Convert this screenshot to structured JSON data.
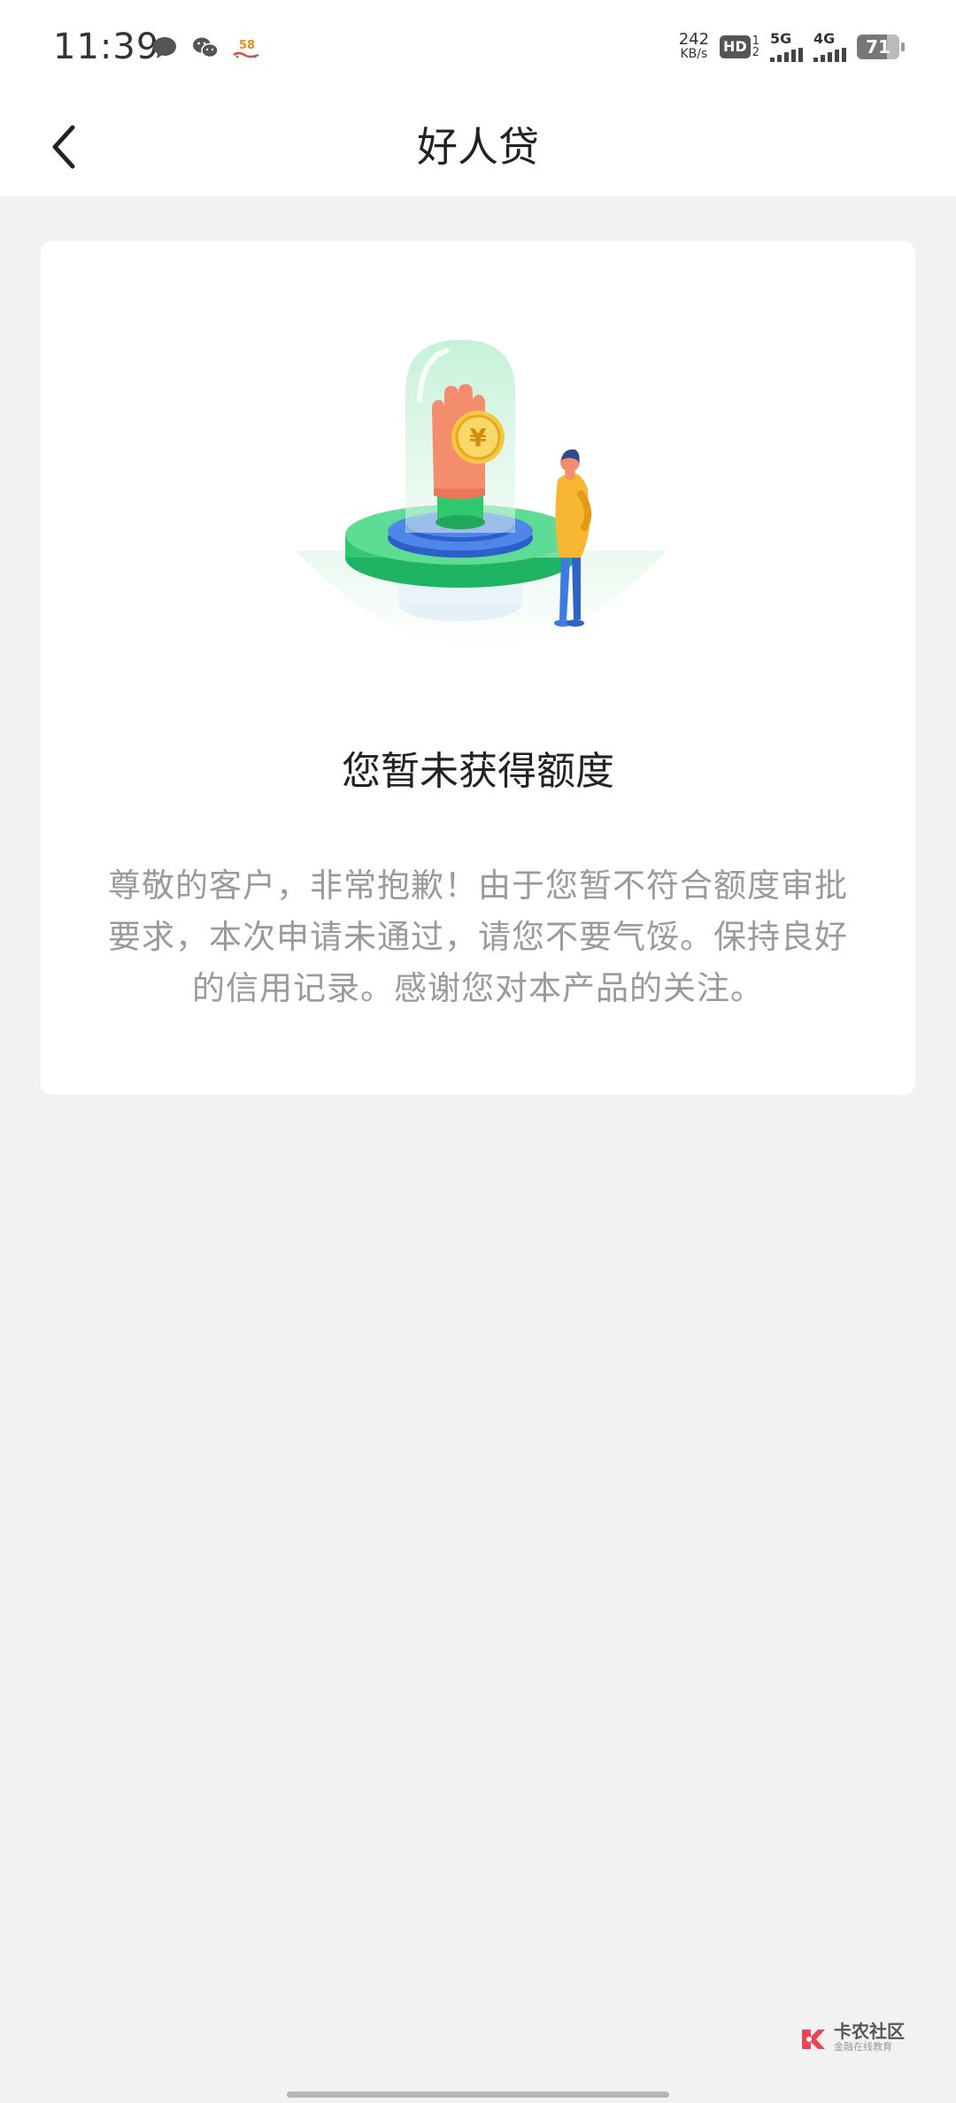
{
  "status_bar": {
    "time": "11:39",
    "notification_icons": [
      "message-bubble-icon",
      "wechat-icon",
      "58-app-icon"
    ],
    "net_speed_value": "242",
    "net_speed_unit": "KB/s",
    "hd_label": "HD",
    "hd_sub_top": "1",
    "hd_sub_bottom": "2",
    "signal_1_label": "5G",
    "signal_2_label": "4G",
    "battery_level": "71"
  },
  "header": {
    "back_icon": "chevron-left-icon",
    "title": "好人贷"
  },
  "result": {
    "illustration": "hand-with-coin-under-glass-dome-illustration",
    "title": "您暂未获得额度",
    "description": "尊敬的客户，非常抱歉！由于您暂不符合额度审批要求，本次申请未通过，请您不要气馁。保持良好的信用记录。感谢您对本产品的关注。"
  },
  "watermark": {
    "name": "卡农社区",
    "tagline": "金融在线教育"
  },
  "colors": {
    "background": "#f2f2f2",
    "card": "#ffffff",
    "accent_green": "#3ecf7a",
    "accent_blue": "#3d6fd6",
    "coin_yellow": "#f5c842"
  }
}
